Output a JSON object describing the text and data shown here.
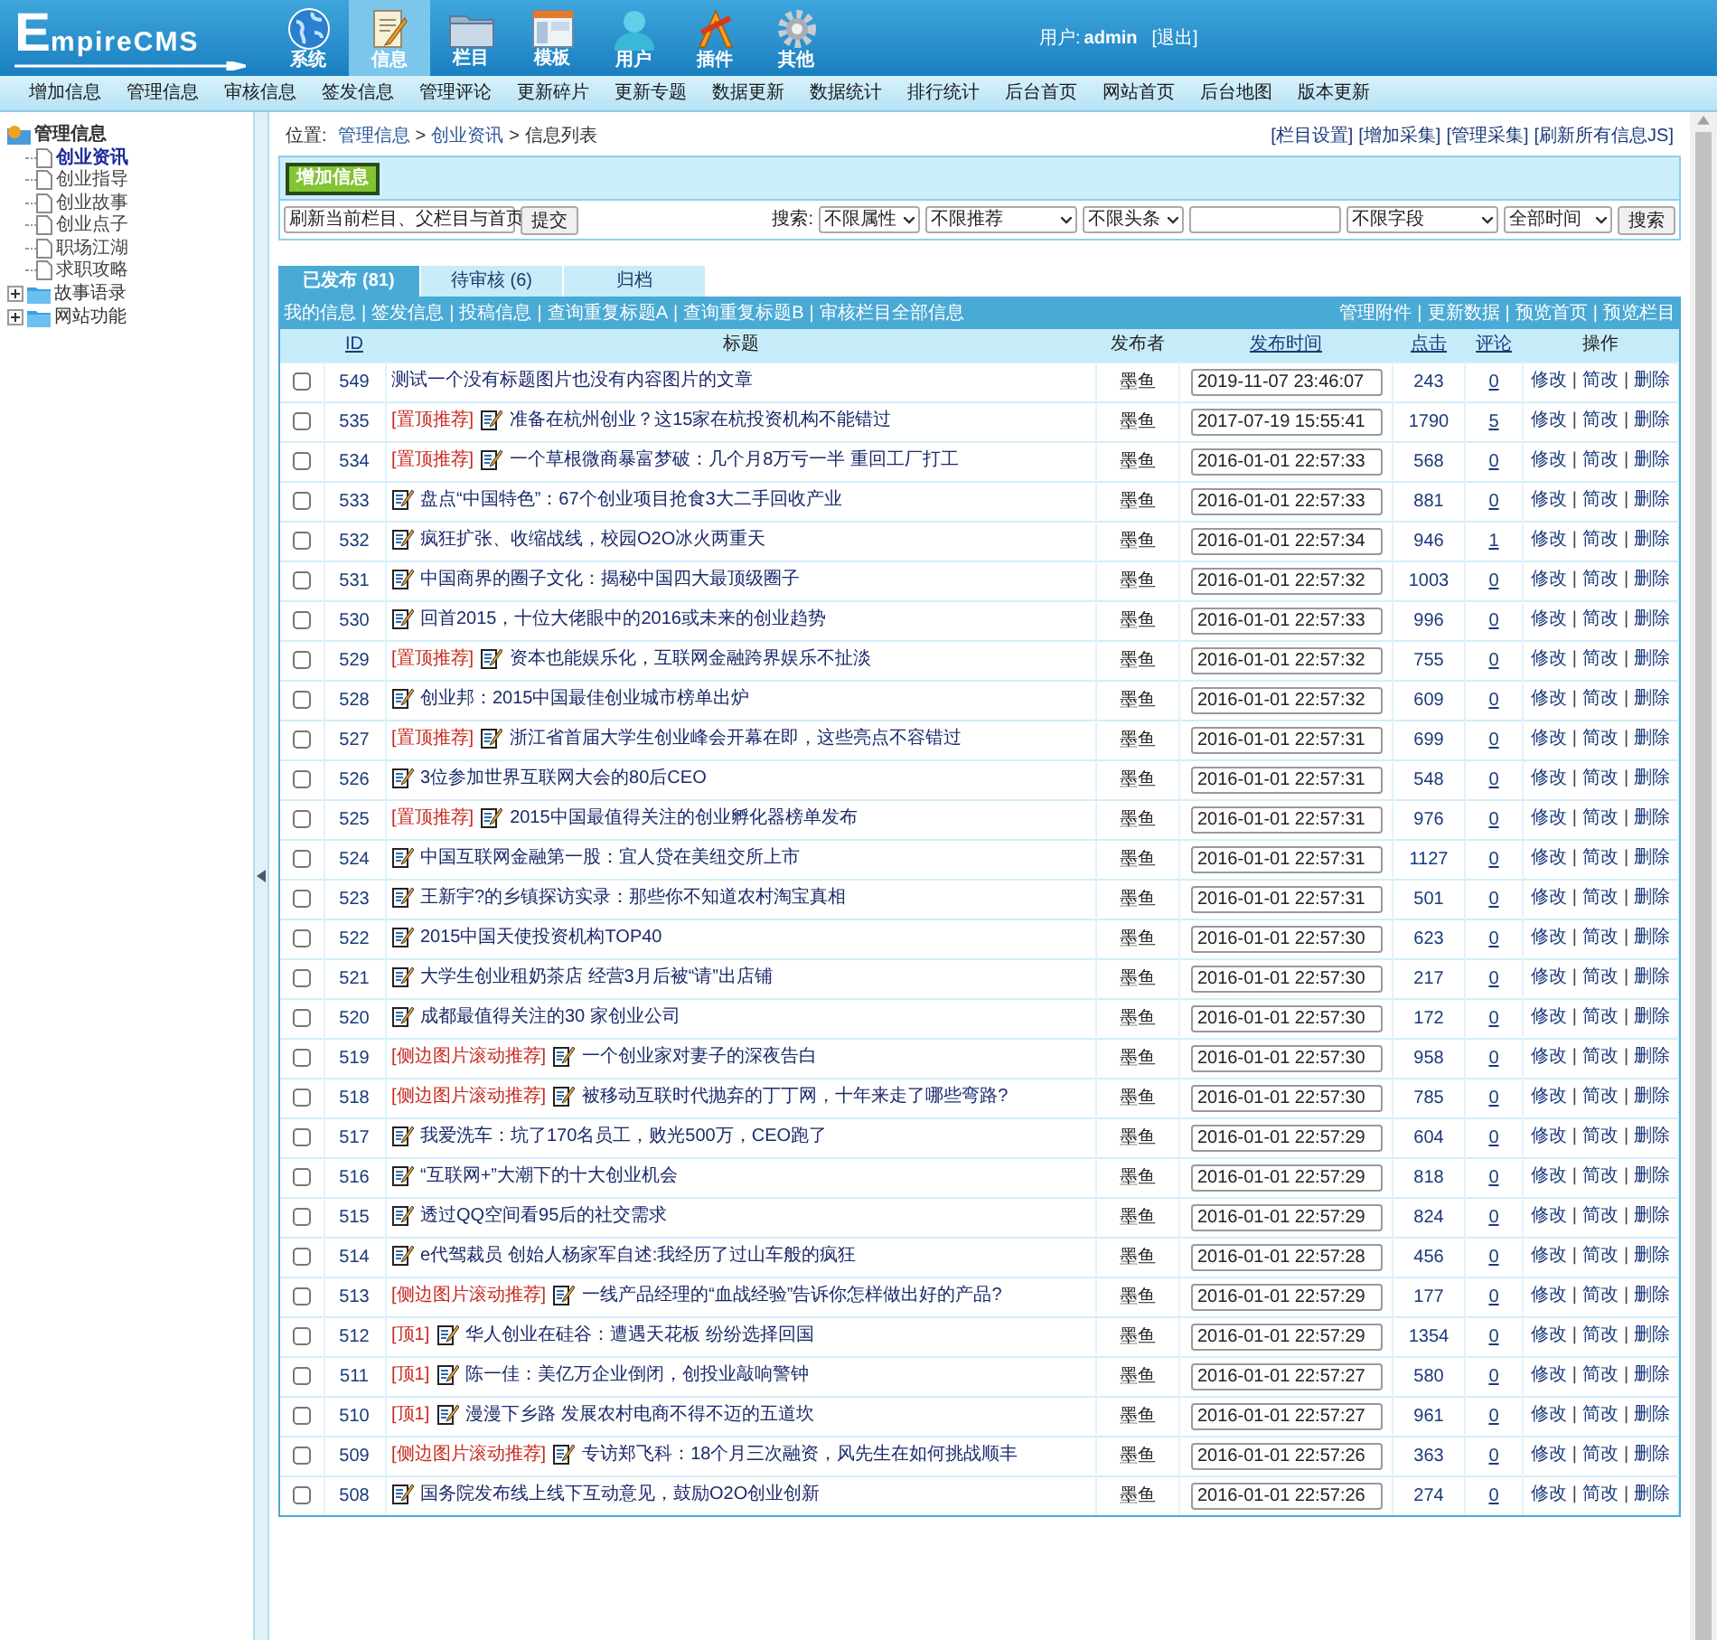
{
  "header": {
    "logo": "EmpireCMS",
    "nav": [
      {
        "label": "系统",
        "selected": false
      },
      {
        "label": "信息",
        "selected": true
      },
      {
        "label": "栏目",
        "selected": false
      },
      {
        "label": "模板",
        "selected": false
      },
      {
        "label": "用户",
        "selected": false
      },
      {
        "label": "插件",
        "selected": false
      },
      {
        "label": "其他",
        "selected": false
      }
    ],
    "user": {
      "label": "用户:",
      "name": "admin",
      "logout": "[退出]"
    }
  },
  "submenu": [
    "增加信息",
    "管理信息",
    "审核信息",
    "签发信息",
    "管理评论",
    "更新碎片",
    "更新专题",
    "数据更新",
    "数据统计",
    "排行统计",
    "后台首页",
    "网站首页",
    "后台地图",
    "版本更新"
  ],
  "sidebar": {
    "tree": [
      {
        "label": "管理信息",
        "selected": false,
        "children": [
          {
            "label": "创业资讯",
            "selected": true
          },
          {
            "label": "创业指导",
            "selected": false
          },
          {
            "label": "创业故事",
            "selected": false
          },
          {
            "label": "创业点子",
            "selected": false
          },
          {
            "label": "职场江湖",
            "selected": false
          },
          {
            "label": "求职攻略",
            "selected": false
          }
        ]
      },
      {
        "label": "故事语录",
        "selected": false,
        "expanded": false
      },
      {
        "label": "网站功能",
        "selected": false,
        "expanded": false
      }
    ]
  },
  "breadcrumb": {
    "label": "位置:",
    "path": [
      "管理信息",
      ">",
      "创业资讯",
      ">",
      "信息列表"
    ]
  },
  "top_links": [
    "[栏目设置]",
    "[增加采集]",
    "[管理采集]",
    "[刷新所有信息JS]"
  ],
  "add_button": "增加信息",
  "refresh": {
    "select": "刷新当前栏目、父栏目与首页",
    "button": "提交"
  },
  "search": {
    "label": "搜索:",
    "filters": [
      {
        "value": "不限属性"
      },
      {
        "value": "不限推荐"
      },
      {
        "value": "不限头条"
      }
    ],
    "fields": [
      {
        "value": "不限字段"
      },
      {
        "value": "全部时间"
      }
    ],
    "button": "搜索"
  },
  "tabs": [
    {
      "label": "已发布 (81)",
      "selected": true
    },
    {
      "label": "待审核 (6)",
      "selected": false
    },
    {
      "label": "归档",
      "selected": false
    }
  ],
  "bar_links_left": [
    "我的信息",
    "|",
    "签发信息",
    "|",
    "投稿信息",
    "|",
    "查询重复标题A",
    "|",
    "查询重复标题B",
    "|",
    "审核栏目全部信息"
  ],
  "bar_links_right": [
    "管理附件",
    "|",
    "更新数据",
    "|",
    "预览首页",
    "|",
    "预览栏目"
  ],
  "table": {
    "columns": [
      {
        "kind": "blank"
      },
      {
        "label": "ID",
        "kind": "link"
      },
      {
        "label": "标题",
        "kind": "text"
      },
      {
        "label": "发布者",
        "kind": "text"
      },
      {
        "label": "发布时间",
        "kind": "link"
      },
      {
        "label": "点击",
        "kind": "link"
      },
      {
        "label": "评论",
        "kind": "link"
      },
      {
        "label": "操作",
        "kind": "text"
      }
    ],
    "rows": [
      {
        "checked": false,
        "id": "549",
        "title": "测试一个没有标题图片也没有内容图片的文章",
        "image": false,
        "publisher": "墨鱼",
        "time": "2019-11-07 23:46:07",
        "clicks": "243",
        "comments": "0",
        "actions": [
          "修改",
          "|",
          "简改",
          "|",
          "删除"
        ]
      },
      {
        "checked": false,
        "id": "535",
        "tag": "[置顶推荐]",
        "title": "准备在杭州创业？这15家在杭投资机构不能错过",
        "image": true,
        "publisher": "墨鱼",
        "time": "2017-07-19 15:55:41",
        "clicks": "1790",
        "comments": "5",
        "actions": [
          "修改",
          "|",
          "简改",
          "|",
          "删除"
        ]
      },
      {
        "checked": false,
        "id": "534",
        "tag": "[置顶推荐]",
        "title": "一个草根微商暴富梦破：几个月8万亏一半 重回工厂打工",
        "image": true,
        "publisher": "墨鱼",
        "time": "2016-01-01 22:57:33",
        "clicks": "568",
        "comments": "0",
        "actions": [
          "修改",
          "|",
          "简改",
          "|",
          "删除"
        ]
      },
      {
        "checked": false,
        "id": "533",
        "title": "盘点“中国特色”：67个创业项目抢食3大二手回收产业",
        "image": true,
        "publisher": "墨鱼",
        "time": "2016-01-01 22:57:33",
        "clicks": "881",
        "comments": "0",
        "actions": [
          "修改",
          "|",
          "简改",
          "|",
          "删除"
        ]
      },
      {
        "checked": false,
        "id": "532",
        "title": "疯狂扩张、收缩战线，校园O2O冰火两重天",
        "image": true,
        "publisher": "墨鱼",
        "time": "2016-01-01 22:57:34",
        "clicks": "946",
        "comments": "1",
        "actions": [
          "修改",
          "|",
          "简改",
          "|",
          "删除"
        ]
      },
      {
        "checked": false,
        "id": "531",
        "title": "中国商界的圈子文化：揭秘中国四大最顶级圈子",
        "image": true,
        "publisher": "墨鱼",
        "time": "2016-01-01 22:57:32",
        "clicks": "1003",
        "comments": "0",
        "actions": [
          "修改",
          "|",
          "简改",
          "|",
          "删除"
        ]
      },
      {
        "checked": false,
        "id": "530",
        "title": "回首2015，十位大佬眼中的2016或未来的创业趋势",
        "image": true,
        "publisher": "墨鱼",
        "time": "2016-01-01 22:57:33",
        "clicks": "996",
        "comments": "0",
        "actions": [
          "修改",
          "|",
          "简改",
          "|",
          "删除"
        ]
      },
      {
        "checked": false,
        "id": "529",
        "tag": "[置顶推荐]",
        "title": "资本也能娱乐化，互联网金融跨界娱乐不扯淡",
        "image": true,
        "publisher": "墨鱼",
        "time": "2016-01-01 22:57:32",
        "clicks": "755",
        "comments": "0",
        "actions": [
          "修改",
          "|",
          "简改",
          "|",
          "删除"
        ]
      },
      {
        "checked": false,
        "id": "528",
        "title": "创业邦：2015中国最佳创业城市榜单出炉",
        "image": true,
        "publisher": "墨鱼",
        "time": "2016-01-01 22:57:32",
        "clicks": "609",
        "comments": "0",
        "actions": [
          "修改",
          "|",
          "简改",
          "|",
          "删除"
        ]
      },
      {
        "checked": false,
        "id": "527",
        "tag": "[置顶推荐]",
        "title": "浙江省首届大学生创业峰会开幕在即，这些亮点不容错过",
        "image": true,
        "publisher": "墨鱼",
        "time": "2016-01-01 22:57:31",
        "clicks": "699",
        "comments": "0",
        "actions": [
          "修改",
          "|",
          "简改",
          "|",
          "删除"
        ]
      },
      {
        "checked": false,
        "id": "526",
        "title": "3位参加世界互联网大会的80后CEO",
        "image": true,
        "publisher": "墨鱼",
        "time": "2016-01-01 22:57:31",
        "clicks": "548",
        "comments": "0",
        "actions": [
          "修改",
          "|",
          "简改",
          "|",
          "删除"
        ]
      },
      {
        "checked": false,
        "id": "525",
        "tag": "[置顶推荐]",
        "title": "2015中国最值得关注的创业孵化器榜单发布",
        "image": true,
        "publisher": "墨鱼",
        "time": "2016-01-01 22:57:31",
        "clicks": "976",
        "comments": "0",
        "actions": [
          "修改",
          "|",
          "简改",
          "|",
          "删除"
        ]
      },
      {
        "checked": false,
        "id": "524",
        "title": "中国互联网金融第一股：宜人贷在美纽交所上市",
        "image": true,
        "publisher": "墨鱼",
        "time": "2016-01-01 22:57:31",
        "clicks": "1127",
        "comments": "0",
        "actions": [
          "修改",
          "|",
          "简改",
          "|",
          "删除"
        ]
      },
      {
        "checked": false,
        "id": "523",
        "title": "王新宇?的乡镇探访实录：那些你不知道农村淘宝真相",
        "image": true,
        "publisher": "墨鱼",
        "time": "2016-01-01 22:57:31",
        "clicks": "501",
        "comments": "0",
        "actions": [
          "修改",
          "|",
          "简改",
          "|",
          "删除"
        ]
      },
      {
        "checked": false,
        "id": "522",
        "title": "2015中国天使投资机构TOP40",
        "image": true,
        "publisher": "墨鱼",
        "time": "2016-01-01 22:57:30",
        "clicks": "623",
        "comments": "0",
        "actions": [
          "修改",
          "|",
          "简改",
          "|",
          "删除"
        ]
      },
      {
        "checked": false,
        "id": "521",
        "title": "大学生创业租奶茶店 经营3月后被“请”出店铺",
        "image": true,
        "publisher": "墨鱼",
        "time": "2016-01-01 22:57:30",
        "clicks": "217",
        "comments": "0",
        "actions": [
          "修改",
          "|",
          "简改",
          "|",
          "删除"
        ]
      },
      {
        "checked": false,
        "id": "520",
        "title": "成都最值得关注的30 家创业公司",
        "image": true,
        "publisher": "墨鱼",
        "time": "2016-01-01 22:57:30",
        "clicks": "172",
        "comments": "0",
        "actions": [
          "修改",
          "|",
          "简改",
          "|",
          "删除"
        ]
      },
      {
        "checked": false,
        "id": "519",
        "tag": "[侧边图片滚动推荐]",
        "title": "一个创业家对妻子的深夜告白",
        "image": true,
        "publisher": "墨鱼",
        "time": "2016-01-01 22:57:30",
        "clicks": "958",
        "comments": "0",
        "actions": [
          "修改",
          "|",
          "简改",
          "|",
          "删除"
        ]
      },
      {
        "checked": false,
        "id": "518",
        "tag": "[侧边图片滚动推荐]",
        "title": "被移动互联时代抛弃的丁丁网，十年来走了哪些弯路?",
        "image": true,
        "publisher": "墨鱼",
        "time": "2016-01-01 22:57:30",
        "clicks": "785",
        "comments": "0",
        "actions": [
          "修改",
          "|",
          "简改",
          "|",
          "删除"
        ]
      },
      {
        "checked": false,
        "id": "517",
        "title": "我爱洗车：坑了170名员工，败光500万，CEO跑了",
        "image": true,
        "publisher": "墨鱼",
        "time": "2016-01-01 22:57:29",
        "clicks": "604",
        "comments": "0",
        "actions": [
          "修改",
          "|",
          "简改",
          "|",
          "删除"
        ]
      },
      {
        "checked": false,
        "id": "516",
        "title": "“互联网+”大潮下的十大创业机会",
        "image": true,
        "publisher": "墨鱼",
        "time": "2016-01-01 22:57:29",
        "clicks": "818",
        "comments": "0",
        "actions": [
          "修改",
          "|",
          "简改",
          "|",
          "删除"
        ]
      },
      {
        "checked": false,
        "id": "515",
        "title": "透过QQ空间看95后的社交需求",
        "image": true,
        "publisher": "墨鱼",
        "time": "2016-01-01 22:57:29",
        "clicks": "824",
        "comments": "0",
        "actions": [
          "修改",
          "|",
          "简改",
          "|",
          "删除"
        ]
      },
      {
        "checked": false,
        "id": "514",
        "title": "e代驾裁员 创始人杨家军自述:我经历了过山车般的疯狂",
        "image": true,
        "publisher": "墨鱼",
        "time": "2016-01-01 22:57:28",
        "clicks": "456",
        "comments": "0",
        "actions": [
          "修改",
          "|",
          "简改",
          "|",
          "删除"
        ]
      },
      {
        "checked": false,
        "id": "513",
        "tag": "[侧边图片滚动推荐]",
        "title": "一线产品经理的“血战经验”告诉你怎样做出好的产品?",
        "image": true,
        "publisher": "墨鱼",
        "time": "2016-01-01 22:57:29",
        "clicks": "177",
        "comments": "0",
        "actions": [
          "修改",
          "|",
          "简改",
          "|",
          "删除"
        ]
      },
      {
        "checked": false,
        "id": "512",
        "tag": "[顶1]",
        "title": "华人创业在硅谷：遭遇天花板 纷纷选择回国",
        "image": true,
        "publisher": "墨鱼",
        "time": "2016-01-01 22:57:29",
        "clicks": "1354",
        "comments": "0",
        "actions": [
          "修改",
          "|",
          "简改",
          "|",
          "删除"
        ]
      },
      {
        "checked": false,
        "id": "511",
        "tag": "[顶1]",
        "title": "陈一佳：美亿万企业倒闭，创投业敲响警钟",
        "image": true,
        "publisher": "墨鱼",
        "time": "2016-01-01 22:57:27",
        "clicks": "580",
        "comments": "0",
        "actions": [
          "修改",
          "|",
          "简改",
          "|",
          "删除"
        ]
      },
      {
        "checked": false,
        "id": "510",
        "tag": "[顶1]",
        "title": "漫漫下乡路 发展农村电商不得不迈的五道坎",
        "image": true,
        "publisher": "墨鱼",
        "time": "2016-01-01 22:57:27",
        "clicks": "961",
        "comments": "0",
        "actions": [
          "修改",
          "|",
          "简改",
          "|",
          "删除"
        ]
      },
      {
        "checked": false,
        "id": "509",
        "tag": "[侧边图片滚动推荐]",
        "title": "专访郑飞科：18个月三次融资，风先生在如何挑战顺丰",
        "image": true,
        "publisher": "墨鱼",
        "time": "2016-01-01 22:57:26",
        "clicks": "363",
        "comments": "0",
        "actions": [
          "修改",
          "|",
          "简改",
          "|",
          "删除"
        ]
      },
      {
        "checked": false,
        "id": "508",
        "title": "国务院发布线上线下互动意见，鼓励O2O创业创新",
        "image": true,
        "publisher": "墨鱼",
        "time": "2016-01-01 22:57:26",
        "clicks": "274",
        "comments": "0",
        "actions": [
          "修改",
          "|",
          "简改",
          "|",
          "删除"
        ]
      }
    ]
  }
}
